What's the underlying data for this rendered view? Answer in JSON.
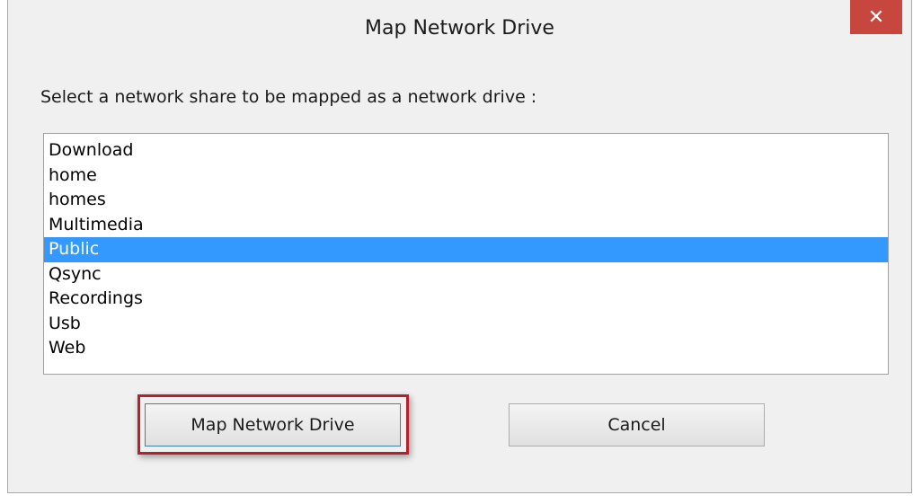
{
  "window": {
    "title": "Map Network Drive",
    "close_glyph": "✕"
  },
  "prompt": "Select a network share to be mapped as a network drive :",
  "shares": {
    "items": [
      "Download",
      "home",
      "homes",
      "Multimedia",
      "Public",
      "Qsync",
      "Recordings",
      "Usb",
      "Web"
    ],
    "selected": "Public"
  },
  "buttons": {
    "map_label": "Map Network Drive",
    "cancel_label": "Cancel"
  },
  "colors": {
    "selection": "#3399ff",
    "close_button": "#c7463d",
    "highlight_frame": "#b5202a"
  }
}
